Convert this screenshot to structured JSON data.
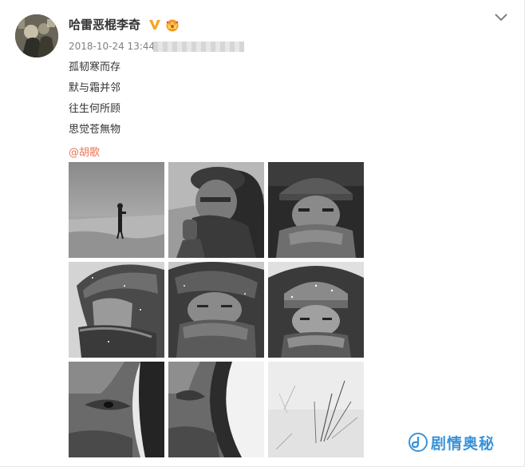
{
  "post": {
    "username": "哈雷恶棍李奇",
    "timestamp": "2018-10-24 13:44",
    "lines": [
      "孤韧寒而存",
      "默与霜并邻",
      "往生何所顾",
      "思觉苍無物"
    ],
    "mention": "@胡歌"
  },
  "icons": {
    "verified": "verified-v-badge-icon",
    "vip": "vip-crown-icon",
    "menu": "chevron-down-icon"
  },
  "photos": [
    {
      "id": "photo-1",
      "subject": "distant figure in snowy field"
    },
    {
      "id": "photo-2",
      "subject": "man in hood lighting cigarette"
    },
    {
      "id": "photo-3",
      "subject": "face close-up in knit hat"
    },
    {
      "id": "photo-4",
      "subject": "profile in snowy hood"
    },
    {
      "id": "photo-5",
      "subject": "hooded face with scarf"
    },
    {
      "id": "photo-6",
      "subject": "face in frosted knit hat"
    },
    {
      "id": "photo-7",
      "subject": "eye close-up"
    },
    {
      "id": "photo-8",
      "subject": "side profile close-up"
    },
    {
      "id": "photo-9",
      "subject": "grass in snow"
    }
  ],
  "watermark": {
    "text": "剧情奥秘"
  },
  "colors": {
    "mention": "#eb7350",
    "watermark": "#3a93d8",
    "verified": "#f5a623"
  }
}
